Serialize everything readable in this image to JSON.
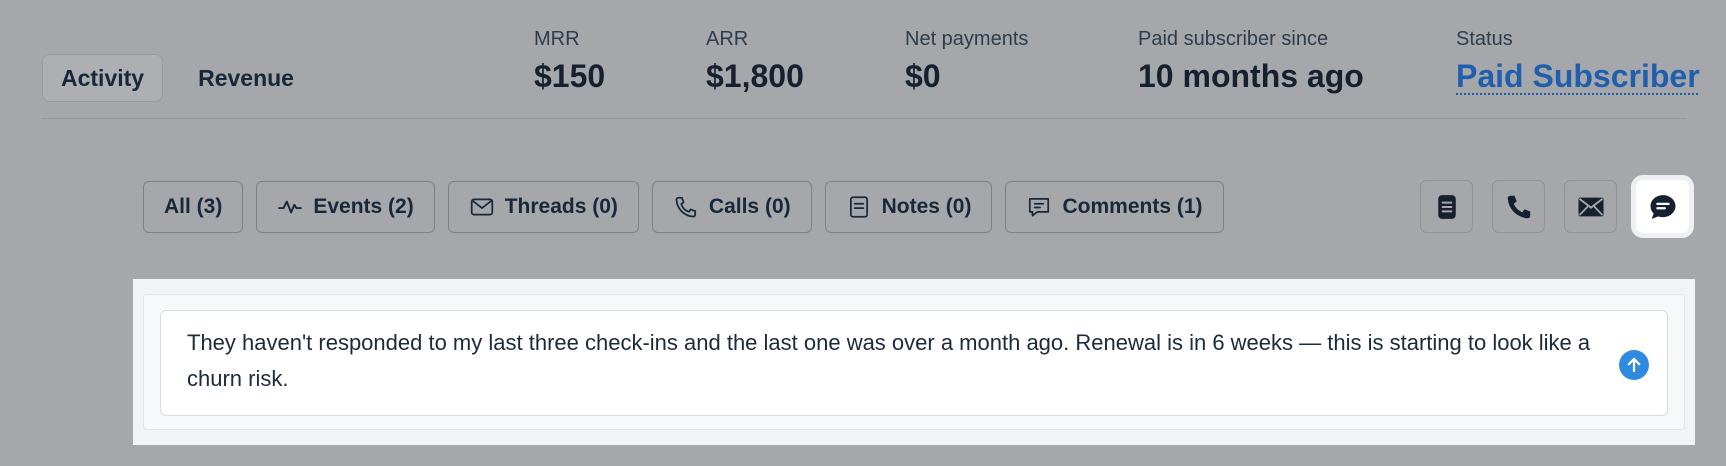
{
  "tabs": [
    {
      "label": "Activity",
      "active": true
    },
    {
      "label": "Revenue",
      "active": false
    }
  ],
  "metrics": {
    "mrr": {
      "label": "MRR",
      "value": "$150"
    },
    "arr": {
      "label": "ARR",
      "value": "$1,800"
    },
    "net_payments": {
      "label": "Net payments",
      "value": "$0"
    },
    "paid_since": {
      "label": "Paid subscriber since",
      "value": "10 months ago"
    },
    "status": {
      "label": "Status",
      "value": "Paid Subscriber"
    }
  },
  "filters": [
    {
      "label": "All (3)",
      "icon": "none"
    },
    {
      "label": "Events (2)",
      "icon": "activity-icon"
    },
    {
      "label": "Threads (0)",
      "icon": "mail-icon"
    },
    {
      "label": "Calls (0)",
      "icon": "phone-icon"
    },
    {
      "label": "Notes (0)",
      "icon": "note-icon"
    },
    {
      "label": "Comments (1)",
      "icon": "comment-icon"
    }
  ],
  "actions": [
    {
      "icon": "note-icon",
      "active": false
    },
    {
      "icon": "phone-icon",
      "active": false
    },
    {
      "icon": "mail-icon",
      "active": false
    },
    {
      "icon": "comment-icon",
      "active": true
    }
  ],
  "composer": {
    "text": "They haven't responded to my last three check-ins and the last one was over a month ago. Renewal is in 6 weeks — this is starting to look like a churn risk.",
    "send_icon": "arrow-up-icon"
  },
  "colors": {
    "background": "#a6a7ab",
    "link": "#1f5fae",
    "send": "#2f8be0",
    "text": "#16202e"
  }
}
